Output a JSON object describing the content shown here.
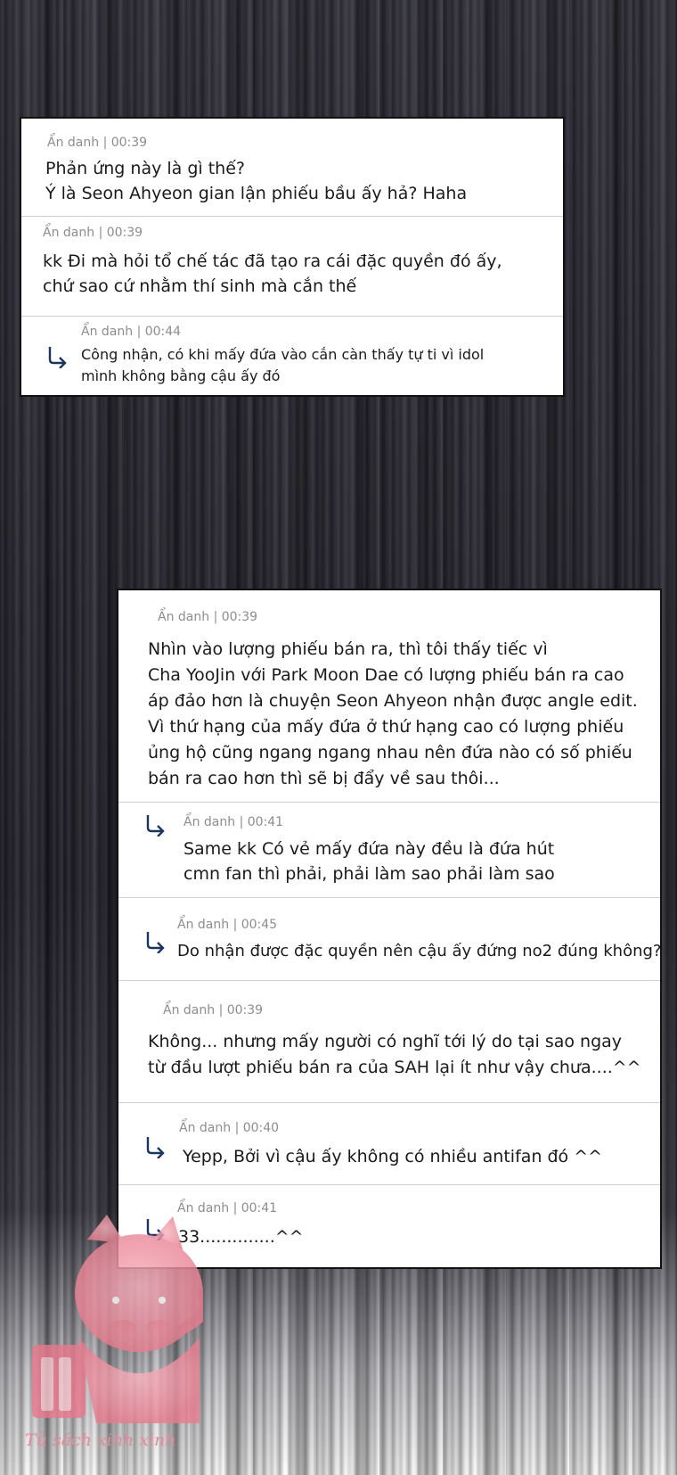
{
  "cards": [
    {
      "comments": [
        {
          "meta": "Ẩn danh | 00:39",
          "lines": [
            "Phản ứng này là gì thế?",
            "Ý là Seon Ahyeon gian lận phiếu bầu ấy hả? Haha"
          ]
        },
        {
          "meta": "Ẩn danh | 00:39",
          "lines": [
            "kk Đi mà hỏi tổ chế tác đã tạo ra cái đặc quyền đó ấy,",
            "chứ sao cứ nhằm thí sinh mà cắn thế"
          ]
        },
        {
          "meta": "Ẩn danh | 00:44",
          "reply": true,
          "lines": [
            "Công nhận, có khi mấy đứa vào cắn càn thấy tự ti vì idol",
            "mình không bằng cậu ấy đó"
          ]
        }
      ]
    },
    {
      "comments": [
        {
          "meta": "Ẩn danh | 00:39",
          "lines": [
            "Nhìn vào lượng phiếu bán ra, thì tôi thấy tiếc vì",
            "Cha YooJin với Park Moon Dae có lượng phiếu bán ra cao",
            "áp đảo hơn là chuyện Seon Ahyeon nhận được angle edit.",
            "Vì thứ hạng của mấy đứa ở thứ hạng cao có lượng phiếu",
            "ủng hộ cũng ngang ngang nhau nên đứa nào có số phiếu",
            "bán ra cao hơn thì sẽ bị đẩy về sau thôi..."
          ]
        },
        {
          "meta": "Ẩn danh | 00:41",
          "reply": true,
          "lines": [
            "Same kk Có vẻ mấy đứa này đều là đứa hút",
            "cmn fan thì phải, phải làm sao phải làm sao"
          ]
        },
        {
          "meta": "Ẩn danh | 00:45",
          "reply": true,
          "lines": [
            "Do nhận được đặc quyền nên cậu ấy đứng no2 đúng không?"
          ]
        },
        {
          "meta": "Ẩn danh | 00:39",
          "lines": [
            "Không... nhưng mấy người có nghĩ tới lý do tại sao ngay",
            "từ đầu lượt phiếu bán ra của SAH lại ít như vậy chưa....^^"
          ]
        },
        {
          "meta": "Ẩn danh | 00:40",
          "reply": true,
          "lines": [
            "Yepp, Bởi vì cậu ấy không có nhiều antifan đó ^^"
          ]
        },
        {
          "meta": "Ẩn danh | 00:41",
          "reply": true,
          "lines": [
            "33..............^^"
          ]
        }
      ]
    }
  ],
  "watermark": {
    "text": "Tủ sách xinh xinh"
  },
  "icons": {
    "reply": "reply-arrow-icon",
    "watermark": "cat-logo-icon"
  }
}
